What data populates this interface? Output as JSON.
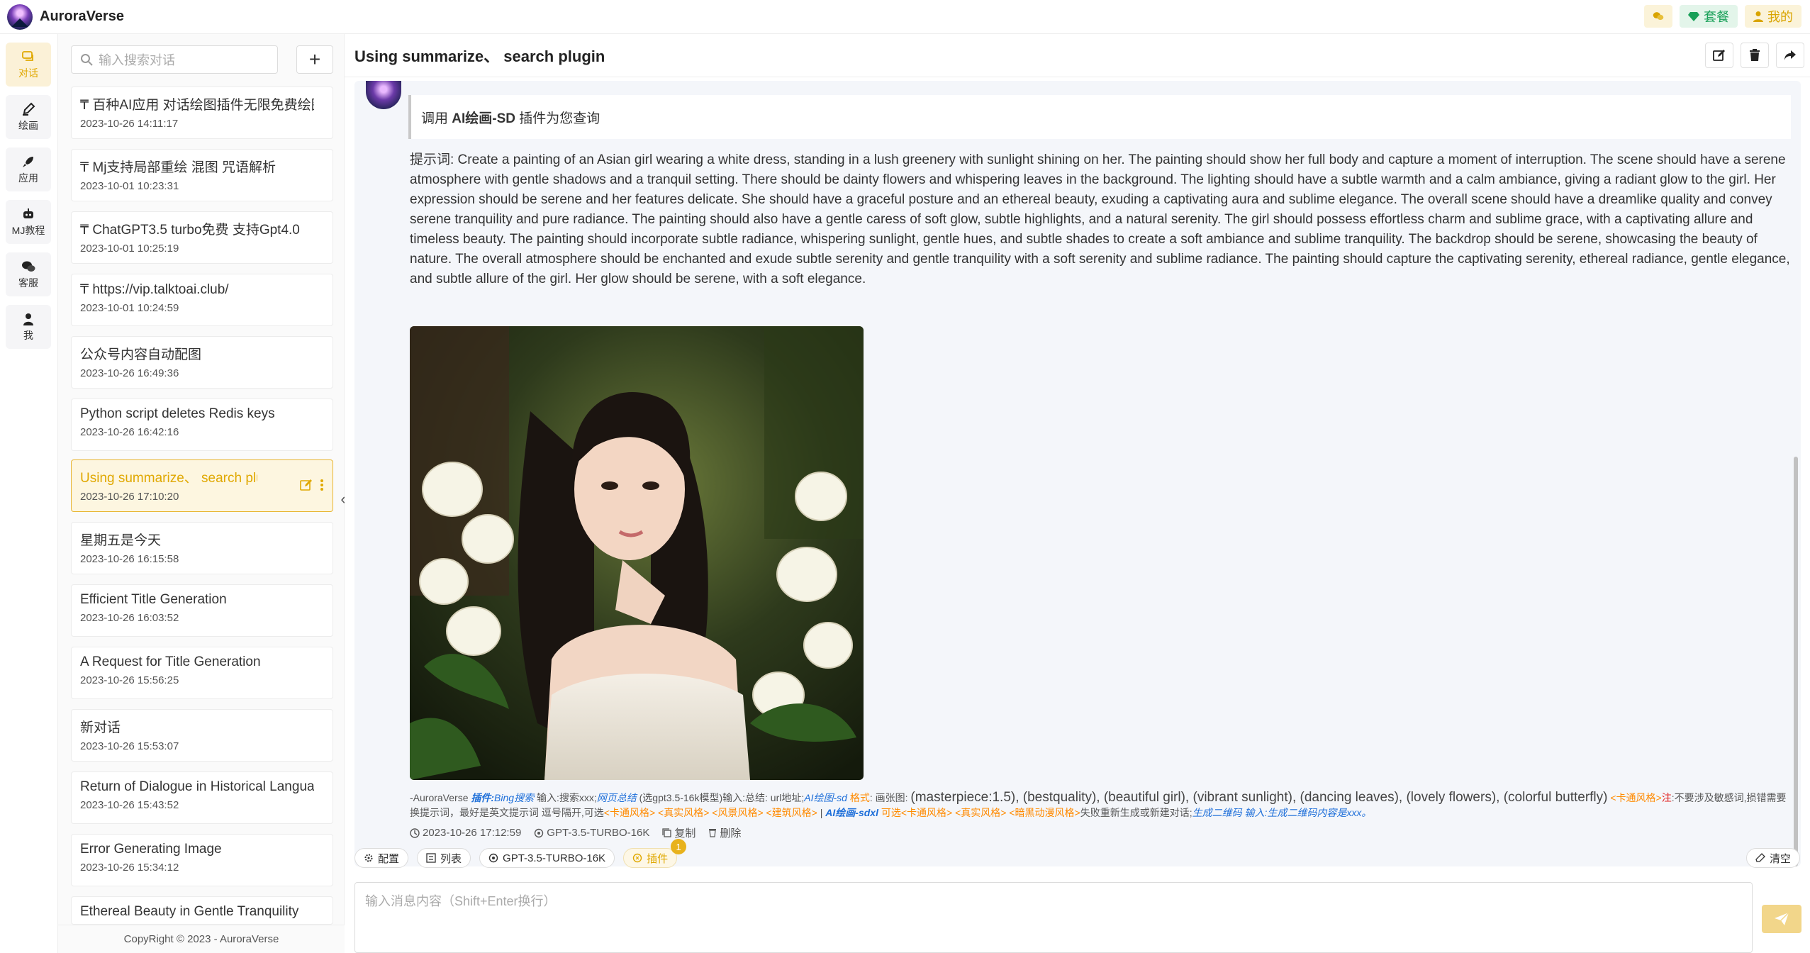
{
  "app": {
    "title": "AuroraVerse"
  },
  "top_actions": {
    "package": "套餐",
    "mine": "我的"
  },
  "rail": [
    {
      "label": "对话",
      "icon": "chat-icon"
    },
    {
      "label": "绘画",
      "icon": "brush-icon"
    },
    {
      "label": "应用",
      "icon": "rocket-icon"
    },
    {
      "label": "MJ教程",
      "icon": "robot-icon"
    },
    {
      "label": "客服",
      "icon": "wechat-icon"
    },
    {
      "label": "我",
      "icon": "user-icon"
    }
  ],
  "search": {
    "placeholder": "输入搜索对话"
  },
  "conversations": [
    {
      "title": "₸ 百种AI应用 对话绘图插件无限免费绘图",
      "time": "2023-10-26 14:11:17"
    },
    {
      "title": "₸ Mj支持局部重绘 混图 咒语解析",
      "time": "2023-10-01 10:23:31"
    },
    {
      "title": "₸ ChatGPT3.5 turbo免费 支持Gpt4.0",
      "time": "2023-10-01 10:25:19"
    },
    {
      "title": "₸ https://vip.talktoai.club/",
      "time": "2023-10-01 10:24:59"
    },
    {
      "title": "公众号内容自动配图",
      "time": "2023-10-26 16:49:36"
    },
    {
      "title": "Python script deletes Redis keys",
      "time": "2023-10-26 16:42:16"
    },
    {
      "title": "Using summarize、 search plugin",
      "time": "2023-10-26 17:10:20"
    },
    {
      "title": "星期五是今天",
      "time": "2023-10-26 16:15:58"
    },
    {
      "title": "Efficient Title Generation",
      "time": "2023-10-26 16:03:52"
    },
    {
      "title": "A Request for Title Generation",
      "time": "2023-10-26 15:56:25"
    },
    {
      "title": "新对话",
      "time": "2023-10-26 15:53:07"
    },
    {
      "title": "Return of Dialogue in Historical Langua",
      "time": "2023-10-26 15:43:52"
    },
    {
      "title": "Error Generating Image",
      "time": "2023-10-26 15:34:12"
    },
    {
      "title": "Ethereal Beauty in Gentle Tranquility",
      "time": ""
    }
  ],
  "copyright": "CopyRight © 2023 - AuroraVerse",
  "chat": {
    "title": "Using summarize、 search plugin",
    "plugin_call_prefix": "调用 ",
    "plugin_name": "AI绘画-SD",
    "plugin_call_suffix": " 插件为您查询",
    "prompt": "提示词: Create a painting of an Asian girl wearing a white dress, standing in a lush greenery with sunlight shining on her. The painting should show her full body and capture a moment of interruption. The scene should have a serene atmosphere with gentle shadows and a tranquil setting. There should be dainty flowers and whispering leaves in the background. The lighting should have a subtle warmth and a calm ambiance, giving a radiant glow to the girl. Her expression should be serene and her features delicate. She should have a graceful posture and an ethereal beauty, exuding a captivating aura and sublime elegance. The overall scene should have a dreamlike quality and convey serene tranquility and pure radiance. The painting should also have a gentle caress of soft glow, subtle highlights, and a natural serenity. The girl should possess effortless charm and sublime grace, with a captivating allure and timeless beauty. The painting should incorporate subtle radiance, whispering sunlight, gentle hues, and subtle shades to create a soft ambiance and sublime tranquility. The backdrop should be serene, showcasing the beauty of nature. The overall atmosphere should be enchanted and exude subtle serenity and gentle tranquility with a soft serenity and sublime radiance. The painting should capture the captivating serenity, ethereal radiance, gentle elegance, and subtle allure of the girl. Her glow should be serene, with a soft elegance.",
    "footer": {
      "a": "-AuroraVerse ",
      "plugin_label": "插件:",
      "bing": "Bing搜索",
      "b": " 输入:搜索xxx;",
      "summary": "网页总结",
      "c": " (选gpt3.5-16k模型)输入:总结: url地址;",
      "sd": "AI绘图-sd",
      "format": " 格式",
      "d": ": 画张图: ",
      "tags": "(masterpiece:1.5), (bestquality), (beautiful girl), (vibrant sunlight), (dancing leaves), (lovely flowers), (colorful butterfly)",
      "style1": " <卡通风格>",
      "note": "注",
      "e": ":不要涉及敏感词,损错需要换提示词，最好是英文提示词 逗号隔开,可选",
      "styles2": "<卡通风格> <真实风格> <风景风格> <建筑风格>",
      "f": " | ",
      "sdxl": "AI绘画-sdxl",
      "g": " 可选",
      "styles3": "<卡通风格> <真实风格> <暗黑动漫风格>",
      "h": "失败重新生成或新建对话;",
      "qr": "生成二维码",
      "i": " 输入:生成二维码内容是xxx。"
    },
    "meta": {
      "time": "2023-10-26 17:12:59",
      "model": "GPT-3.5-TURBO-16K",
      "copy": "复制",
      "delete": "删除"
    }
  },
  "toolbar": {
    "config": "配置",
    "list": "列表",
    "model": "GPT-3.5-TURBO-16K",
    "plugin": "插件",
    "plugin_badge": "1",
    "clear": "清空"
  },
  "input": {
    "placeholder": "输入消息内容（Shift+Enter换行）"
  },
  "colors": {
    "accent": "#e0a800",
    "green": "#18a058",
    "link": "#1e6fd9",
    "orange": "#ff8a00"
  }
}
